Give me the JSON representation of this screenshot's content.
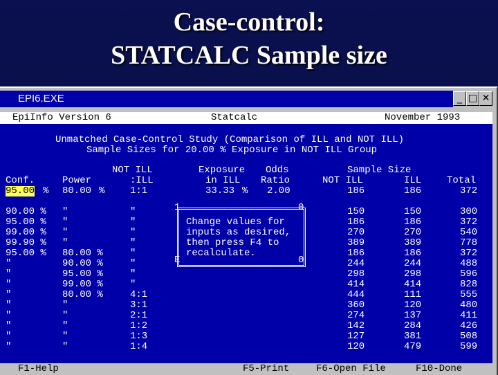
{
  "slide": {
    "title_line1": "Case-control:",
    "title_line2": "STATCALC Sample size"
  },
  "window": {
    "title": "EPI6.EXE",
    "buttons": {
      "minimize": "_",
      "maximize": "□",
      "close": "✕"
    }
  },
  "menubar": {
    "left": "EpiInfo Version 6",
    "center": "Statcalc",
    "right": "November 1993"
  },
  "heading": {
    "line1": "Unmatched Case-Control Study (Comparison of ILL and NOT ILL)",
    "line2": "Sample Sizes for 20.00 % Exposure in NOT ILL Group"
  },
  "columns": {
    "conf": [
      "Conf."
    ],
    "power": [
      "Power"
    ],
    "ratio": [
      "NOT ILL",
      ":ILL"
    ],
    "exposure": [
      "Exposure",
      "in ILL"
    ],
    "odds": [
      "Odds",
      "Ratio"
    ],
    "sample_size": "Sample Size",
    "not_ill": "NOT ILL",
    "ill": "ILL",
    "total": "Total"
  },
  "input_row": {
    "conf": "95.00",
    "conf_unit": "%",
    "power": "80.00",
    "power_unit": "%",
    "ratio": "1:1",
    "exposure": "33.33",
    "exposure_unit": "%",
    "odds": "2.00",
    "not_ill": "186",
    "ill": "186",
    "total": "372"
  },
  "rows": [
    {
      "conf": "90.00 %",
      "power": "\"",
      "ratio": "\"",
      "not_ill": "150",
      "ill": "150",
      "total": "300"
    },
    {
      "conf": "95.00 %",
      "power": "\"",
      "ratio": "\"",
      "not_ill": "186",
      "ill": "186",
      "total": "372"
    },
    {
      "conf": "99.00 %",
      "power": "\"",
      "ratio": "\"",
      "not_ill": "270",
      "ill": "270",
      "total": "540"
    },
    {
      "conf": "99.90 %",
      "power": "\"",
      "ratio": "\"",
      "not_ill": "389",
      "ill": "389",
      "total": "778"
    },
    {
      "conf": "95.00 %",
      "power": "80.00 %",
      "ratio": "\"",
      "not_ill": "186",
      "ill": "186",
      "total": "372"
    },
    {
      "conf": "\"",
      "power": "90.00 %",
      "ratio": "\"",
      "not_ill": "244",
      "ill": "244",
      "total": "488"
    },
    {
      "conf": "\"",
      "power": "95.00 %",
      "ratio": "\"",
      "not_ill": "298",
      "ill": "298",
      "total": "596"
    },
    {
      "conf": "\"",
      "power": "99.00 %",
      "ratio": "\"",
      "not_ill": "414",
      "ill": "414",
      "total": "828"
    },
    {
      "conf": "\"",
      "power": "80.00 %",
      "ratio": "4:1",
      "not_ill": "444",
      "ill": "111",
      "total": "555"
    },
    {
      "conf": "\"",
      "power": "\"",
      "ratio": "3:1",
      "not_ill": "360",
      "ill": "120",
      "total": "480"
    },
    {
      "conf": "\"",
      "power": "\"",
      "ratio": "2:1",
      "not_ill": "274",
      "ill": "137",
      "total": "411"
    },
    {
      "conf": "\"",
      "power": "\"",
      "ratio": "1:2",
      "not_ill": "142",
      "ill": "284",
      "total": "426"
    },
    {
      "conf": "\"",
      "power": "\"",
      "ratio": "1:3",
      "not_ill": "127",
      "ill": "381",
      "total": "508"
    },
    {
      "conf": "\"",
      "power": "\"",
      "ratio": "1:4",
      "not_ill": "120",
      "ill": "479",
      "total": "599"
    }
  ],
  "dialog": {
    "corner_tl": "1",
    "corner_tr": "0",
    "corner_bl": "E",
    "corner_br": "0",
    "lines": [
      "Change values for",
      "inputs as desired,",
      "then press F4 to",
      "recalculate."
    ]
  },
  "bottombar": {
    "f1": "F1-Help",
    "f5": "F5-Print",
    "f6": "F6-Open File",
    "f10": "F10-Done"
  },
  "colors": {
    "screen": "#0000a8",
    "highlight": "#ffff55",
    "titlebar": "#0000a8"
  }
}
